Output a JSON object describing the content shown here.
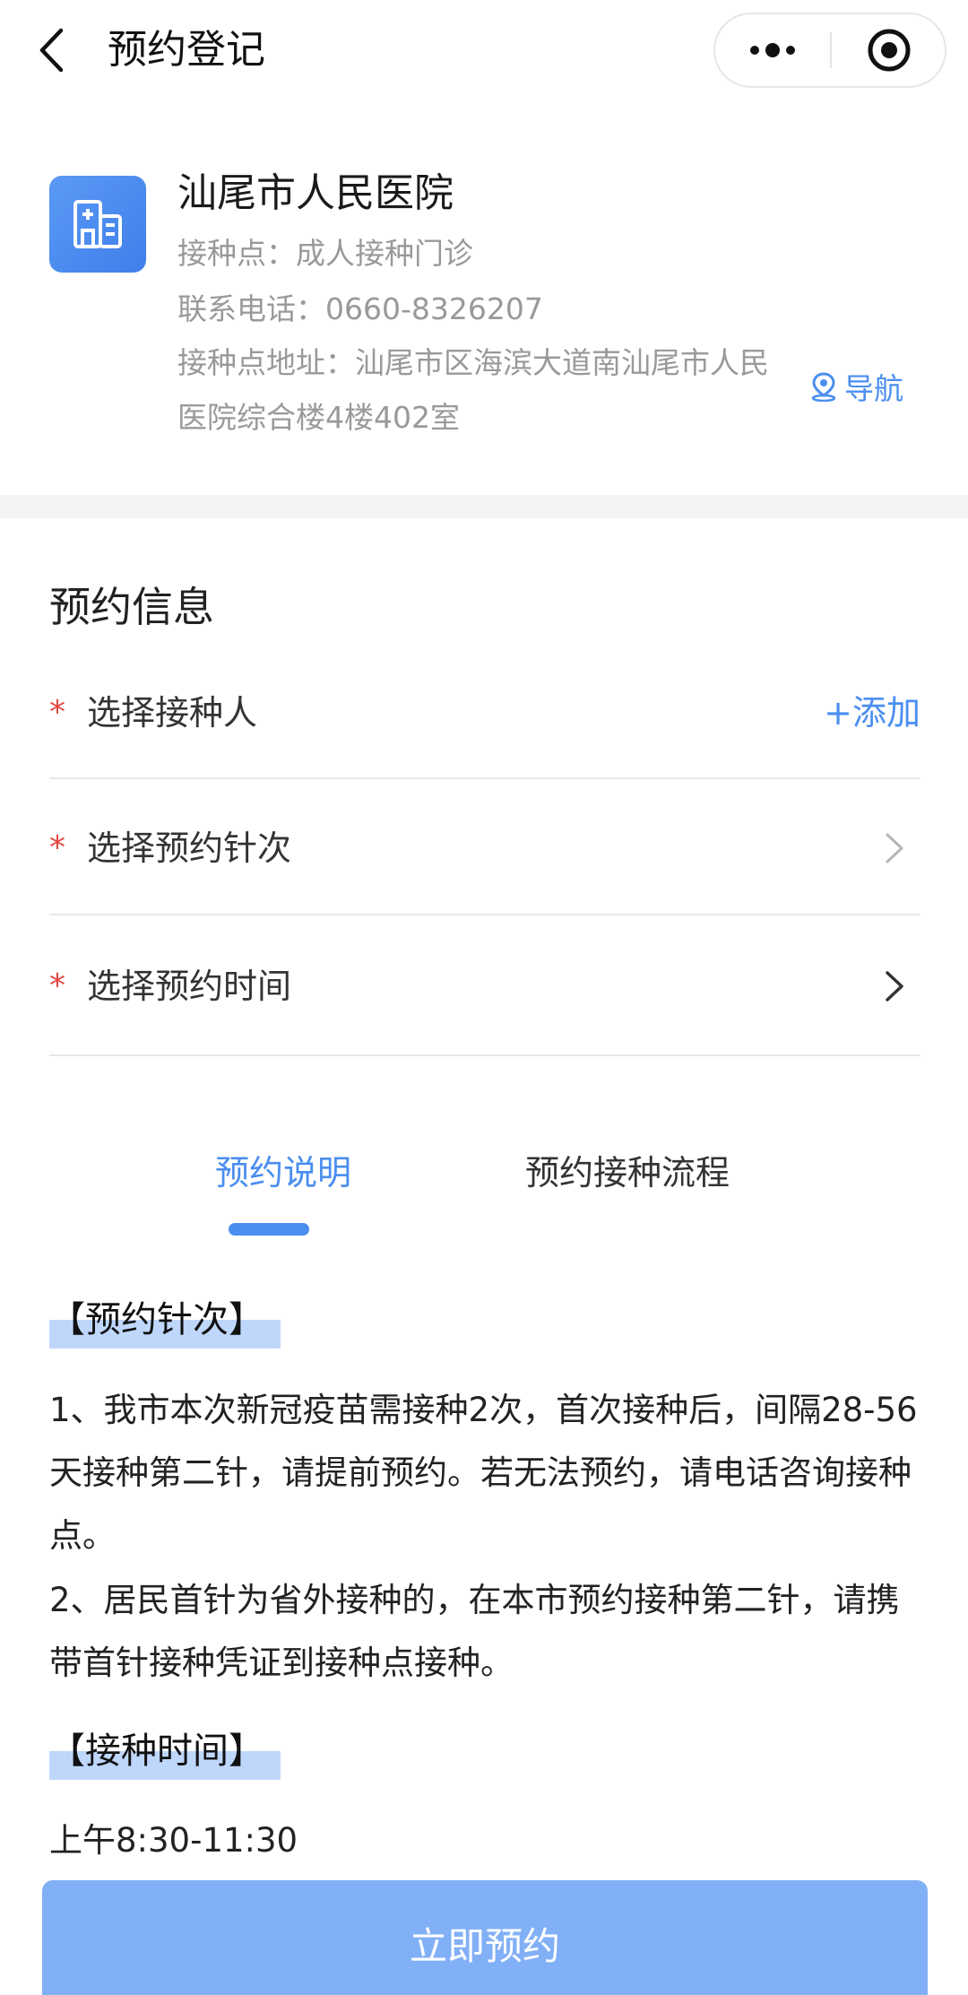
{
  "navbar": {
    "title": "预约登记",
    "back_icon": "chevron-left-icon",
    "more_icon": "more-dots-icon",
    "close_icon": "target-circle-icon"
  },
  "hospital": {
    "logo_icon": "hospital-icon",
    "name": "汕尾市人民医院",
    "site": "接种点：成人接种门诊",
    "phone": "联系电话：0660-8326207",
    "address": "接种点地址：汕尾市区海滨大道南汕尾市人民医院综合楼4楼402室",
    "nav_label": "导航",
    "nav_icon": "location-pin-icon"
  },
  "appointment": {
    "section_title": "预约信息",
    "rows": [
      {
        "required_mark": "*",
        "label": "选择接种人",
        "action": "+添加"
      },
      {
        "required_mark": "*",
        "label": "选择预约针次"
      },
      {
        "required_mark": "*",
        "label": "选择预约时间"
      }
    ]
  },
  "tabs": [
    {
      "label": "预约说明",
      "active": true
    },
    {
      "label": "预约接种流程",
      "active": false
    }
  ],
  "content": {
    "heading_dose": "【预约针次】",
    "para_1": "1、我市本次新冠疫苗需接种2次，首次接种后，间隔28-56天接种第二针，请提前预约。若无法预约，请电话咨询接种点。",
    "para_2": "2、居民首针为省外接种的，在本市预约接种第二针，请携带首针接种凭证到接种点接种。",
    "heading_time": "【接种时间】",
    "time_line": "上午8:30-11:30"
  },
  "submit": {
    "label": "立即预约"
  },
  "colors": {
    "accent": "#4a8ef0",
    "required": "#e5463f",
    "button": "#82b0f7",
    "highlight": "#bfd7fb"
  }
}
